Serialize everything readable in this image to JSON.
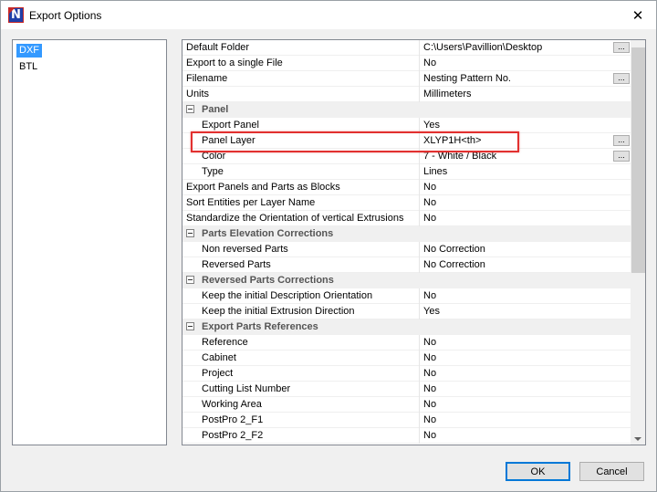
{
  "window": {
    "title": "Export Options",
    "close_symbol": "✕",
    "icon": "app-logo-icon",
    "icon_letter": "N"
  },
  "formats": [
    {
      "label": "DXF",
      "selected": true
    },
    {
      "label": "BTL",
      "selected": false
    }
  ],
  "properties": [
    {
      "type": "row",
      "name": "Default Folder",
      "value": "C:\\Users\\Pavillion\\Desktop",
      "ellipsis": true
    },
    {
      "type": "row",
      "name": "Export to a single File",
      "value": "No"
    },
    {
      "type": "row",
      "name": "Filename",
      "value": "Nesting Pattern No.",
      "ellipsis": true
    },
    {
      "type": "row",
      "name": "Units",
      "value": "Millimeters"
    },
    {
      "type": "category",
      "name": "Panel"
    },
    {
      "type": "sub",
      "name": "Export Panel",
      "value": "Yes"
    },
    {
      "type": "sub",
      "name": "Panel Layer",
      "value": "XLYP1H<th>",
      "ellipsis": true
    },
    {
      "type": "sub",
      "name": "Color",
      "value": "7 - White / Black",
      "ellipsis": true
    },
    {
      "type": "sub",
      "name": "Type",
      "value": "Lines"
    },
    {
      "type": "row",
      "name": "Export Panels and Parts as Blocks",
      "value": "No"
    },
    {
      "type": "row",
      "name": "Sort Entities per Layer Name",
      "value": "No"
    },
    {
      "type": "row",
      "name": "Standardize the Orientation of vertical Extrusions",
      "value": "No"
    },
    {
      "type": "category",
      "name": "Parts Elevation Corrections"
    },
    {
      "type": "sub",
      "name": "Non reversed Parts",
      "value": "No Correction"
    },
    {
      "type": "sub",
      "name": "Reversed Parts",
      "value": "No Correction"
    },
    {
      "type": "category",
      "name": "Reversed Parts Corrections"
    },
    {
      "type": "sub",
      "name": "Keep the initial Description Orientation",
      "value": "No"
    },
    {
      "type": "sub",
      "name": "Keep the initial Extrusion Direction",
      "value": "Yes"
    },
    {
      "type": "category",
      "name": "Export Parts References"
    },
    {
      "type": "sub",
      "name": "Reference",
      "value": "No"
    },
    {
      "type": "sub",
      "name": "Cabinet",
      "value": "No"
    },
    {
      "type": "sub",
      "name": "Project",
      "value": "No"
    },
    {
      "type": "sub",
      "name": "Cutting List Number",
      "value": "No"
    },
    {
      "type": "sub",
      "name": "Working Area",
      "value": "No"
    },
    {
      "type": "sub",
      "name": "PostPro 2_F1",
      "value": "No"
    },
    {
      "type": "sub",
      "name": "PostPro 2_F2",
      "value": "No"
    }
  ],
  "ellipsis_label": "...",
  "buttons": {
    "ok": "OK",
    "cancel": "Cancel"
  },
  "colors": {
    "selection": "#3399ff",
    "highlight_box": "#e2302f",
    "default_button_border": "#0078d7"
  }
}
